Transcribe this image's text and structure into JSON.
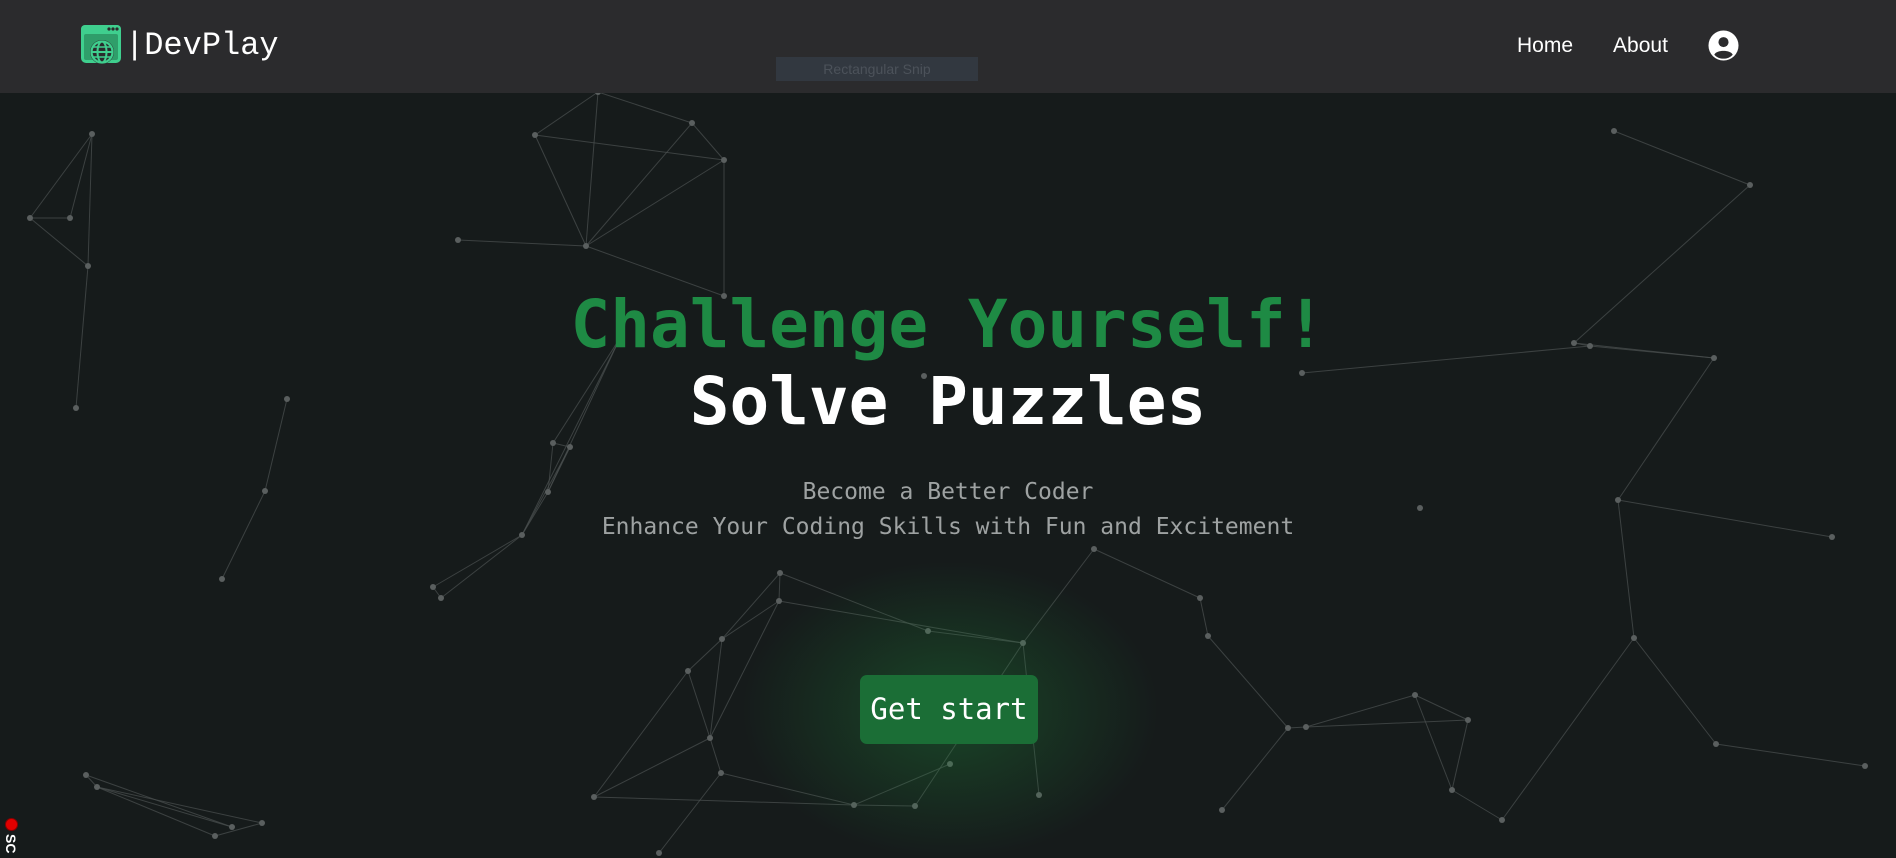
{
  "navbar": {
    "brand_name": "|DevPlay",
    "brand_logo_icon": "globe-window-icon",
    "links": [
      {
        "label": "Home"
      },
      {
        "label": "About"
      }
    ],
    "account_icon": "user-circle-icon"
  },
  "overlay": {
    "snip_label": "Rectangular Snip",
    "recording_text": "SC"
  },
  "hero": {
    "title": "Challenge Yourself!",
    "subtitle": "Solve Puzzles",
    "tagline_line1": "Become a Better Coder",
    "tagline_line2": "Enhance Your Coding Skills with Fun and Excitement",
    "cta_label": "Get start"
  },
  "colors": {
    "background": "#161b1b",
    "navbar": "#2b2b2d",
    "accent_green": "#1e8a44",
    "button_green": "#1b6e36",
    "logo_green": "#3fcf8e"
  }
}
